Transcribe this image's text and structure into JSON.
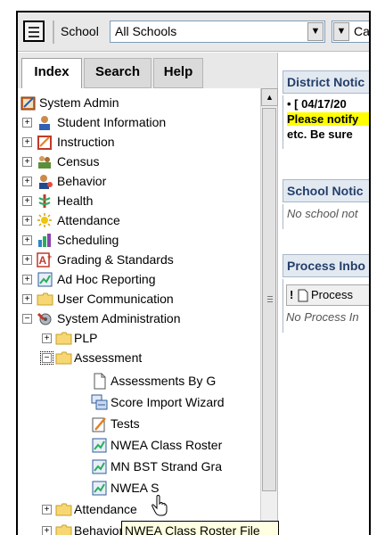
{
  "toolbar": {
    "school_label": "School",
    "school_value": "All Schools",
    "second_select_value": "Ca"
  },
  "tabs": [
    {
      "label": "Index"
    },
    {
      "label": "Search"
    },
    {
      "label": "Help"
    }
  ],
  "tree": {
    "root": "System Admin",
    "items": [
      {
        "label": "Student Information"
      },
      {
        "label": "Instruction"
      },
      {
        "label": "Census"
      },
      {
        "label": "Behavior"
      },
      {
        "label": "Health"
      },
      {
        "label": "Attendance"
      },
      {
        "label": "Scheduling"
      },
      {
        "label": "Grading & Standards"
      },
      {
        "label": "Ad Hoc Reporting"
      },
      {
        "label": "User Communication"
      },
      {
        "label": "System Administration"
      }
    ],
    "sysadmin_children": {
      "plp": "PLP",
      "assessment": "Assessment",
      "assessment_children": [
        {
          "label": "Assessments By G"
        },
        {
          "label": "Score Import Wizard"
        },
        {
          "label": "Tests"
        },
        {
          "label": "NWEA Class Roster"
        },
        {
          "label": "MN BST Strand Gra"
        },
        {
          "label": "NWEA S"
        }
      ],
      "attendance": "Attendance",
      "behavior": "Behavior"
    }
  },
  "right": {
    "district_title": "District Notic",
    "district_line1": "• [ 04/17/20",
    "district_line2": "Please notify",
    "district_line3": "etc.  Be sure",
    "school_title": "School Notic",
    "school_body": "No school not",
    "process_title": "Process Inbo",
    "process_col_icon": "!",
    "process_col_label": "Process",
    "process_body": "No Process In"
  },
  "tooltip": "NWEA Class Roster File",
  "colors": {
    "panel_title_text": "#243f6b",
    "highlight": "#ffff00",
    "tooltip_bg": "#ffffe1"
  }
}
